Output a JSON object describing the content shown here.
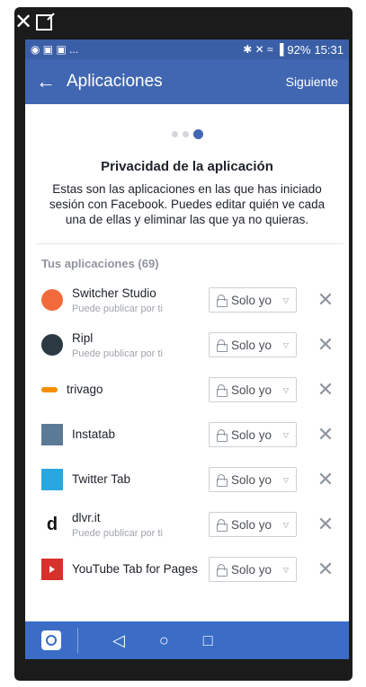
{
  "statusbar": {
    "left_icons": "◉ ▣ ▣ ...",
    "right_icons": "✱ ✕ ≈ ▐",
    "battery": "92%",
    "time": "15:31"
  },
  "appbar": {
    "title": "Aplicaciones",
    "next_label": "Siguiente"
  },
  "page": {
    "heading": "Privacidad de la aplicación",
    "description": "Estas son las aplicaciones en las que has iniciado sesión con Facebook. Puedes editar quién ve cada una de ellas y eliminar las que ya no quieras.",
    "section_title": "Tus aplicaciones (69)"
  },
  "apps": [
    {
      "name": "Switcher Studio",
      "sub": "Puede publicar por ti",
      "audience": "Solo yo",
      "icon": "switcher-studio-icon",
      "icon_color": "#f26a3c"
    },
    {
      "name": "Ripl",
      "sub": "Puede publicar por ti",
      "audience": "Solo yo",
      "icon": "ripl-icon",
      "icon_color": "#2b3a42"
    },
    {
      "name": "trivago",
      "sub": "",
      "audience": "Solo yo",
      "icon": "trivago-icon",
      "icon_color": "#f48f00"
    },
    {
      "name": "Instatab",
      "sub": "",
      "audience": "Solo yo",
      "icon": "instatab-icon",
      "icon_color": "#5b7a96"
    },
    {
      "name": "Twitter Tab",
      "sub": "",
      "audience": "Solo yo",
      "icon": "twitter-tab-icon",
      "icon_color": "#29a8e0"
    },
    {
      "name": "dlvr.it",
      "sub": "Puede publicar por ti",
      "audience": "Solo yo",
      "icon": "dlvrit-icon",
      "icon_color": "#111111"
    },
    {
      "name": "YouTube Tab for Pages",
      "sub": "",
      "audience": "Solo yo",
      "icon": "youtube-tab-icon",
      "icon_color": "#d9302c"
    }
  ],
  "colors": {
    "brand": "#4267b2",
    "statusbar": "#3b5fa7",
    "navbar": "#3b6dc6"
  }
}
